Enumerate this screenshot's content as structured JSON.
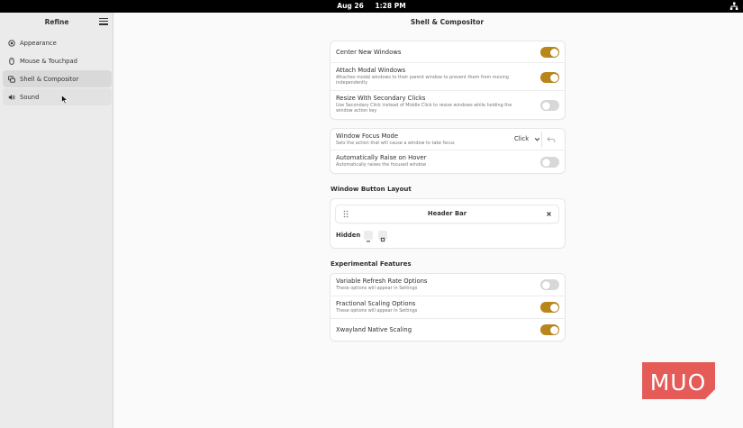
{
  "topbar": {
    "date": "Aug 26",
    "time": "1:28 PM",
    "system_icon": "network-icon"
  },
  "sidebar": {
    "title": "Refine",
    "menu_icon": "hamburger-menu-icon",
    "items": [
      {
        "label": "Appearance",
        "icon": "appearance-icon"
      },
      {
        "label": "Mouse & Touchpad",
        "icon": "mouse-icon"
      },
      {
        "label": "Shell & Compositor",
        "icon": "windows-icon",
        "active": true
      },
      {
        "label": "Sound",
        "icon": "speaker-icon"
      }
    ]
  },
  "main": {
    "title": "Shell & Compositor",
    "group1": [
      {
        "title": "Center New Windows",
        "subtitle": "",
        "on": true
      },
      {
        "title": "Attach Modal Windows",
        "subtitle": "Attaches modal windows to their parent window to prevent them from moving independently",
        "on": true
      },
      {
        "title": "Resize With Secondary Clicks",
        "subtitle": "Use Secondary Click instead of Middle Click to resize windows while holding the window action key",
        "on": false
      }
    ],
    "group2": {
      "focus": {
        "title": "Window Focus Mode",
        "subtitle": "Sets the action that will cause a window to take focus",
        "value": "Click"
      },
      "raise": {
        "title": "Automatically Raise on Hover",
        "subtitle": "Automatically raises the focused window",
        "on": false
      }
    },
    "window_button_layout": {
      "heading": "Window Button Layout",
      "bar_label": "Header Bar",
      "hidden_label": "Hidden"
    },
    "experimental": {
      "heading": "Experimental Features",
      "rows": [
        {
          "title": "Variable Refresh Rate Options",
          "subtitle": "These options will appear in Settings",
          "on": false
        },
        {
          "title": "Fractional Scaling Options",
          "subtitle": "These options will appear in Settings",
          "on": true
        },
        {
          "title": "Xwayland Native Scaling",
          "subtitle": "",
          "on": true
        }
      ]
    }
  },
  "colors": {
    "accent": "#b8861b",
    "sidebar_bg": "#ebebeb",
    "watermark": "#e45b57"
  },
  "watermark": {
    "text": "MUO"
  }
}
